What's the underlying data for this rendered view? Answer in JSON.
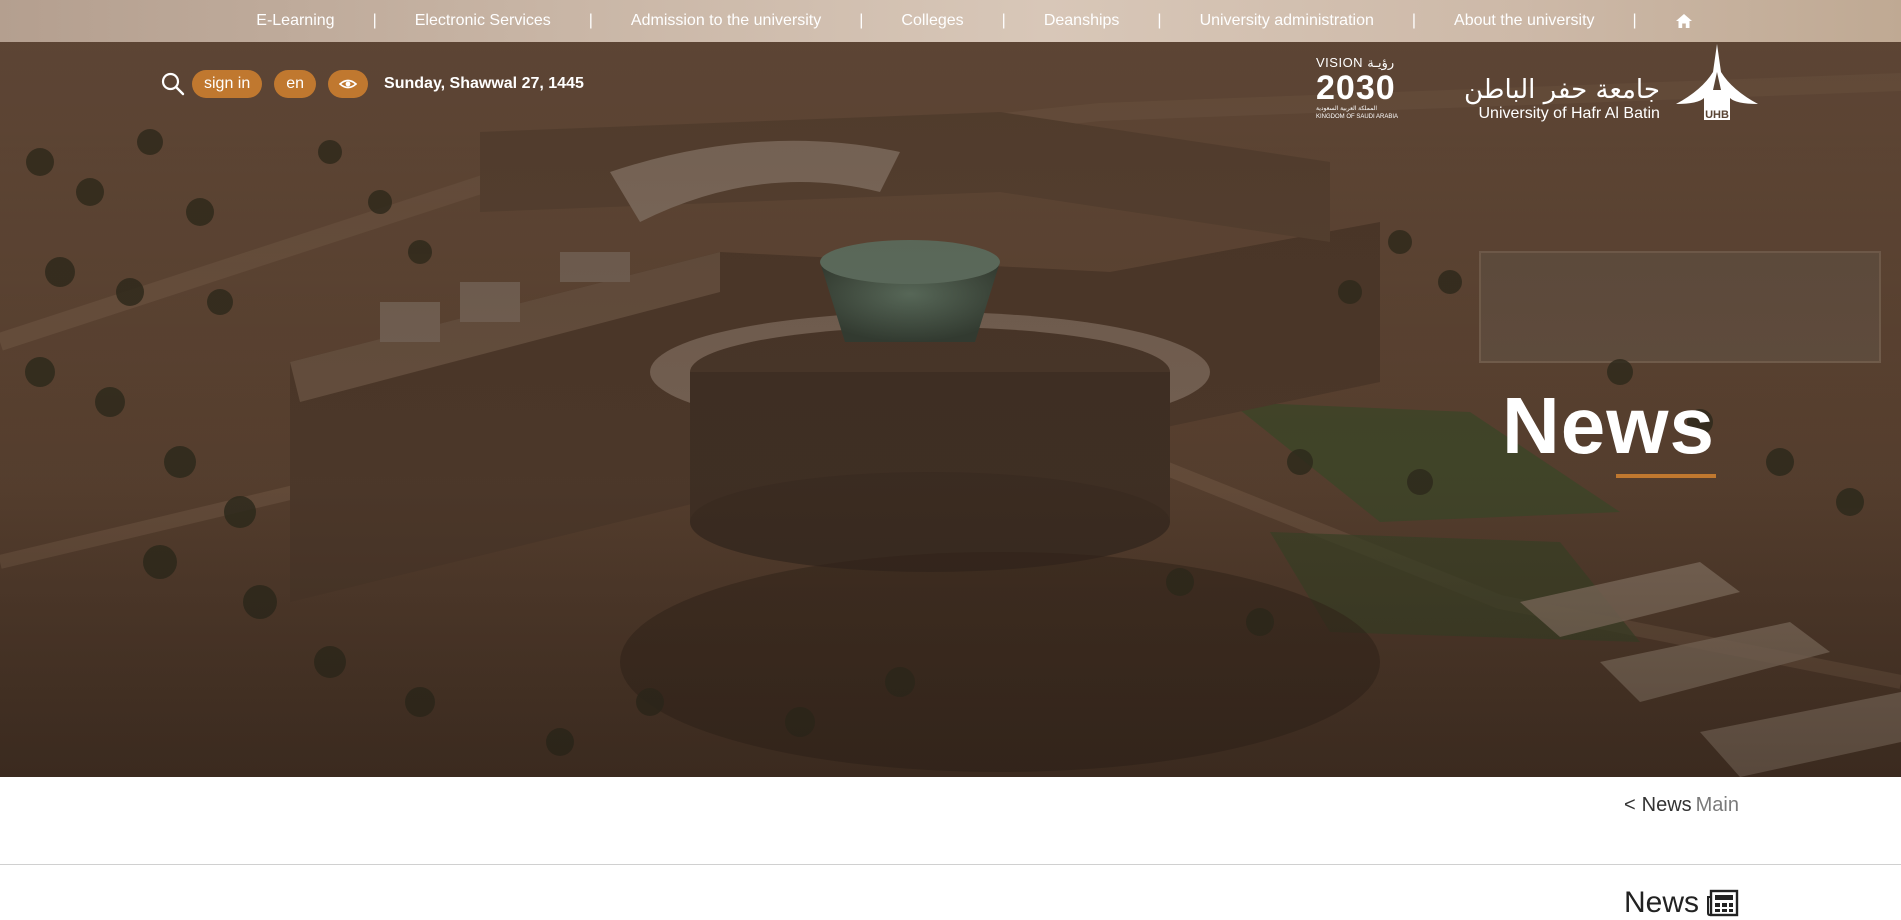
{
  "topnav": {
    "items": [
      "E-Learning",
      "Electronic Services",
      "Admission to the university",
      "Colleges",
      "Deanships",
      "University administration",
      "About the university"
    ],
    "separator": "|",
    "home_icon": "home-icon"
  },
  "utility": {
    "search_icon": "search-icon",
    "sign_in": "sign in",
    "language": "en",
    "accessibility_icon": "eye-icon",
    "date": "Sunday, Shawwal 27, 1445"
  },
  "vision_logo": {
    "top_text": "VISION رؤيـة",
    "year": "2030",
    "sub_arabic": "المملكة العربية السعودية",
    "sub_english": "KINGDOM OF SAUDI ARABIA"
  },
  "university_logo": {
    "arabic_name": "جامعة حفر الباطن",
    "english_name": "University of Hafr Al Batin",
    "mark_text": "UHB"
  },
  "hero": {
    "title": "News"
  },
  "breadcrumb": {
    "chevron": "<",
    "parent": "News",
    "current": "Main"
  },
  "section": {
    "title": "News",
    "icon": "newspaper-icon"
  },
  "colors": {
    "accent": "#c0782f",
    "hero_tint": "#57402f",
    "nav_bar": "#cdb9a8"
  }
}
